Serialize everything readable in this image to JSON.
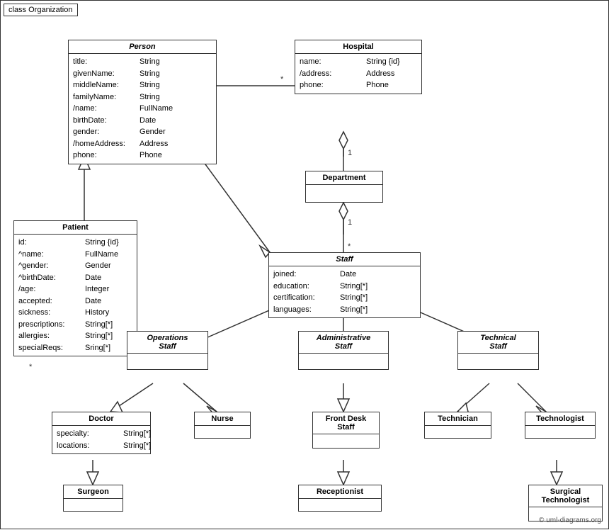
{
  "diagram": {
    "title": "class Organization",
    "copyright": "© uml-diagrams.org",
    "classes": {
      "person": {
        "name": "Person",
        "italic": true,
        "attrs": [
          {
            "name": "title:",
            "type": "String"
          },
          {
            "name": "givenName:",
            "type": "String"
          },
          {
            "name": "middleName:",
            "type": "String"
          },
          {
            "name": "familyName:",
            "type": "String"
          },
          {
            "name": "/name:",
            "type": "FullName"
          },
          {
            "name": "birthDate:",
            "type": "Date"
          },
          {
            "name": "gender:",
            "type": "Gender"
          },
          {
            "name": "/homeAddress:",
            "type": "Address"
          },
          {
            "name": "phone:",
            "type": "Phone"
          }
        ]
      },
      "hospital": {
        "name": "Hospital",
        "italic": false,
        "attrs": [
          {
            "name": "name:",
            "type": "String {id}"
          },
          {
            "name": "/address:",
            "type": "Address"
          },
          {
            "name": "phone:",
            "type": "Phone"
          }
        ]
      },
      "department": {
        "name": "Department",
        "italic": false,
        "attrs": []
      },
      "staff": {
        "name": "Staff",
        "italic": true,
        "attrs": [
          {
            "name": "joined:",
            "type": "Date"
          },
          {
            "name": "education:",
            "type": "String[*]"
          },
          {
            "name": "certification:",
            "type": "String[*]"
          },
          {
            "name": "languages:",
            "type": "String[*]"
          }
        ]
      },
      "patient": {
        "name": "Patient",
        "italic": false,
        "attrs": [
          {
            "name": "id:",
            "type": "String {id}"
          },
          {
            "name": "^name:",
            "type": "FullName"
          },
          {
            "name": "^gender:",
            "type": "Gender"
          },
          {
            "name": "^birthDate:",
            "type": "Date"
          },
          {
            "name": "/age:",
            "type": "Integer"
          },
          {
            "name": "accepted:",
            "type": "Date"
          },
          {
            "name": "sickness:",
            "type": "History"
          },
          {
            "name": "prescriptions:",
            "type": "String[*]"
          },
          {
            "name": "allergies:",
            "type": "String[*]"
          },
          {
            "name": "specialReqs:",
            "type": "Sring[*]"
          }
        ]
      },
      "operations_staff": {
        "name": "Operations\nStaff",
        "italic": true,
        "attrs": []
      },
      "administrative_staff": {
        "name": "Administrative\nStaff",
        "italic": true,
        "attrs": []
      },
      "technical_staff": {
        "name": "Technical\nStaff",
        "italic": true,
        "attrs": []
      },
      "doctor": {
        "name": "Doctor",
        "italic": false,
        "attrs": [
          {
            "name": "specialty:",
            "type": "String[*]"
          },
          {
            "name": "locations:",
            "type": "String[*]"
          }
        ]
      },
      "nurse": {
        "name": "Nurse",
        "italic": false,
        "attrs": []
      },
      "front_desk_staff": {
        "name": "Front Desk\nStaff",
        "italic": false,
        "attrs": []
      },
      "technician": {
        "name": "Technician",
        "italic": false,
        "attrs": []
      },
      "technologist": {
        "name": "Technologist",
        "italic": false,
        "attrs": []
      },
      "surgeon": {
        "name": "Surgeon",
        "italic": false,
        "attrs": []
      },
      "receptionist": {
        "name": "Receptionist",
        "italic": false,
        "attrs": []
      },
      "surgical_technologist": {
        "name": "Surgical\nTechnologist",
        "italic": false,
        "attrs": []
      }
    }
  }
}
